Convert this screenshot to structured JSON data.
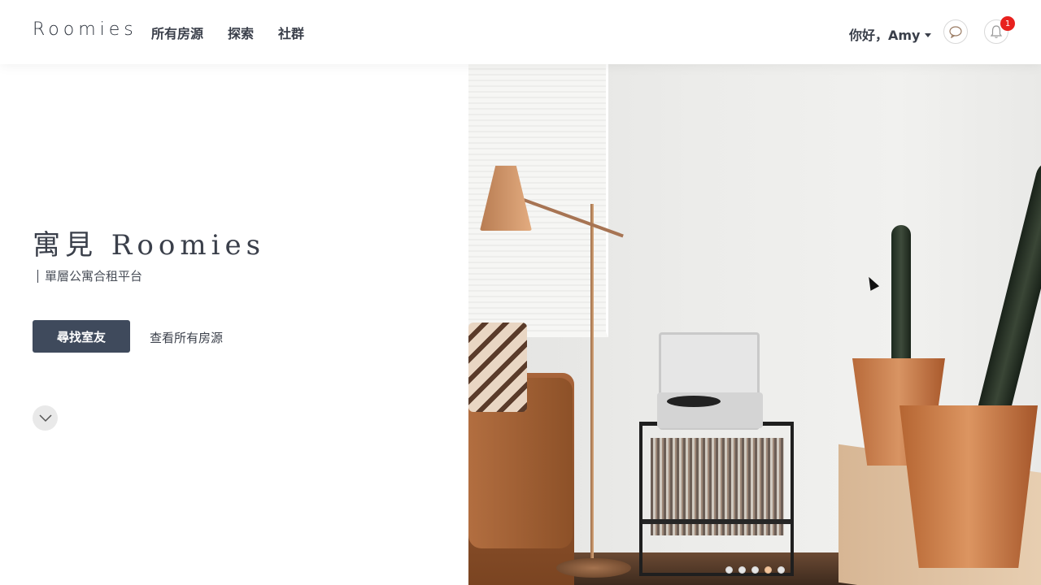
{
  "header": {
    "logo": "Roomies",
    "nav": [
      {
        "label": "所有房源"
      },
      {
        "label": "探索"
      },
      {
        "label": "社群"
      }
    ],
    "greeting": "你好，Amy",
    "notification_count": "1"
  },
  "hero": {
    "title": "寓見 Roomies",
    "subtitle": "單層公寓合租平台",
    "primary_button": "尋找室友",
    "secondary_link": "查看所有房源"
  },
  "carousel": {
    "slide_count": 5,
    "active_index": 4
  },
  "icons": {
    "chat": "chat-bubble-icon",
    "bell": "bell-icon",
    "scroll": "chevron-down-icon"
  },
  "colors": {
    "primary_button": "#3f4a5c",
    "badge": "#e8211e",
    "active_dot": "#f2c49b"
  }
}
